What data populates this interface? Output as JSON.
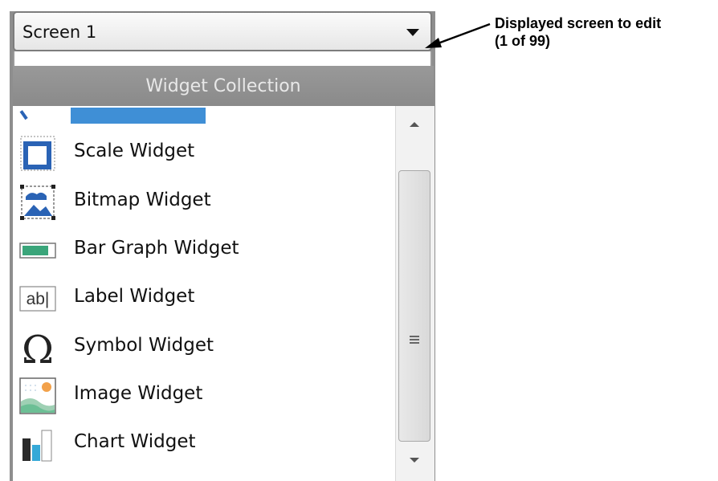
{
  "dropdown": {
    "selected": "Screen 1"
  },
  "panel": {
    "header": "Widget Collection"
  },
  "widgets": [
    {
      "label": "Scale Widget",
      "icon": "scale-widget-icon"
    },
    {
      "label": "Bitmap Widget",
      "icon": "bitmap-widget-icon"
    },
    {
      "label": "Bar Graph Widget",
      "icon": "bar-graph-widget-icon"
    },
    {
      "label": "Label Widget",
      "icon": "label-widget-icon",
      "icon_text": "ab|"
    },
    {
      "label": "Symbol Widget",
      "icon": "symbol-widget-icon",
      "icon_text": "Ω"
    },
    {
      "label": "Image Widget",
      "icon": "image-widget-icon"
    },
    {
      "label": "Chart Widget",
      "icon": "chart-widget-icon"
    }
  ],
  "annotation": {
    "line1": "Displayed screen to edit",
    "line2": "(1 of 99)"
  },
  "colors": {
    "selection": "#3f8fd6",
    "header_bg": "#8e8e8e",
    "icon_blue": "#2a63b5",
    "bar_green": "#3aa57a"
  }
}
